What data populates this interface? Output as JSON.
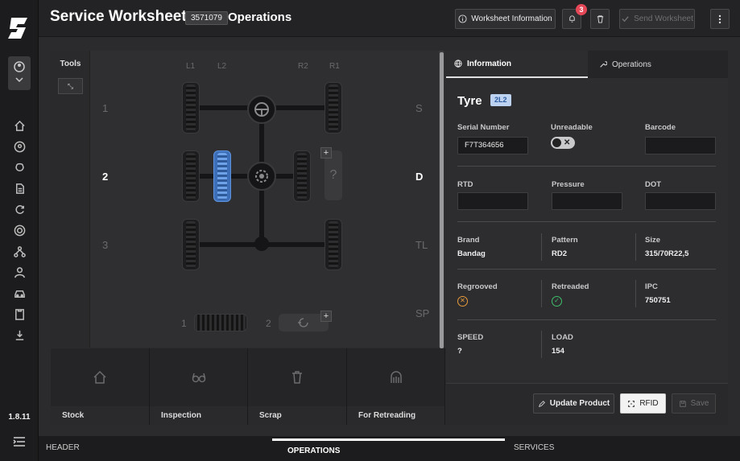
{
  "app": {
    "version": "1.8.11"
  },
  "header": {
    "title": "Service Worksheet",
    "worksheet_id": "3571079",
    "subtitle": "Operations",
    "worksheet_info_label": "Worksheet Information",
    "notification_count": "3",
    "send_label": "Send Worksheet"
  },
  "sidebar": {
    "icons": [
      "home-icon",
      "user-circle-icon",
      "github-icon",
      "document-icon",
      "refresh-icon",
      "target-icon",
      "network-icon",
      "person-icon",
      "car-icon",
      "clipboard-icon",
      "download-icon"
    ]
  },
  "diagram": {
    "tools_label": "Tools",
    "tools_button": "⤡",
    "columns": [
      "L1",
      "L2",
      "R2",
      "R1"
    ],
    "axles": [
      "1",
      "2",
      "3"
    ],
    "side_labels": [
      "S",
      "D",
      "TL",
      "SP"
    ],
    "unknown_mark": "?",
    "add_mark": "+",
    "spares": [
      "1",
      "2"
    ]
  },
  "destinations": [
    {
      "label": "Stock",
      "icon": "home-icon"
    },
    {
      "label": "Inspection",
      "icon": "glasses-icon"
    },
    {
      "label": "Scrap",
      "icon": "trash-icon"
    },
    {
      "label": "For Retreading",
      "icon": "retread-icon"
    }
  ],
  "info_panel": {
    "tabs": [
      "Information",
      "Operations"
    ],
    "heading": "Tyre",
    "position_badge": "2L2",
    "fields": {
      "serial_label": "Serial Number",
      "serial_value": "F7T364656",
      "unreadable_label": "Unreadable",
      "unreadable_on": false,
      "toggle_mark": "✕",
      "barcode_label": "Barcode",
      "barcode_value": "",
      "rtd_label": "RTD",
      "rtd_value": "",
      "pressure_label": "Pressure",
      "pressure_value": "",
      "dot_label": "DOT",
      "dot_value": "",
      "brand_label": "Brand",
      "brand_value": "Bandag",
      "pattern_label": "Pattern",
      "pattern_value": "RD2",
      "size_label": "Size",
      "size_value": "315/70R22,5",
      "regrooved_label": "Regrooved",
      "regrooved_mark": "✕",
      "retreaded_label": "Retreaded",
      "retreaded_mark": "✓",
      "ipc_label": "IPC",
      "ipc_value": "750751",
      "speed_label": "SPEED",
      "speed_value": "?",
      "load_label": "LOAD",
      "load_value": "154"
    },
    "buttons": {
      "update": "Update Product",
      "rfid": "RFID",
      "save": "Save"
    }
  },
  "bottom_nav": {
    "items": [
      "HEADER",
      "OPERATIONS",
      "SERVICES"
    ],
    "active": "OPERATIONS"
  },
  "colors": {
    "accent_blue": "#3d6fb8",
    "badge_red": "#e64757",
    "ok_green": "#3fbf6a",
    "warn_orange": "#e69a3a"
  }
}
